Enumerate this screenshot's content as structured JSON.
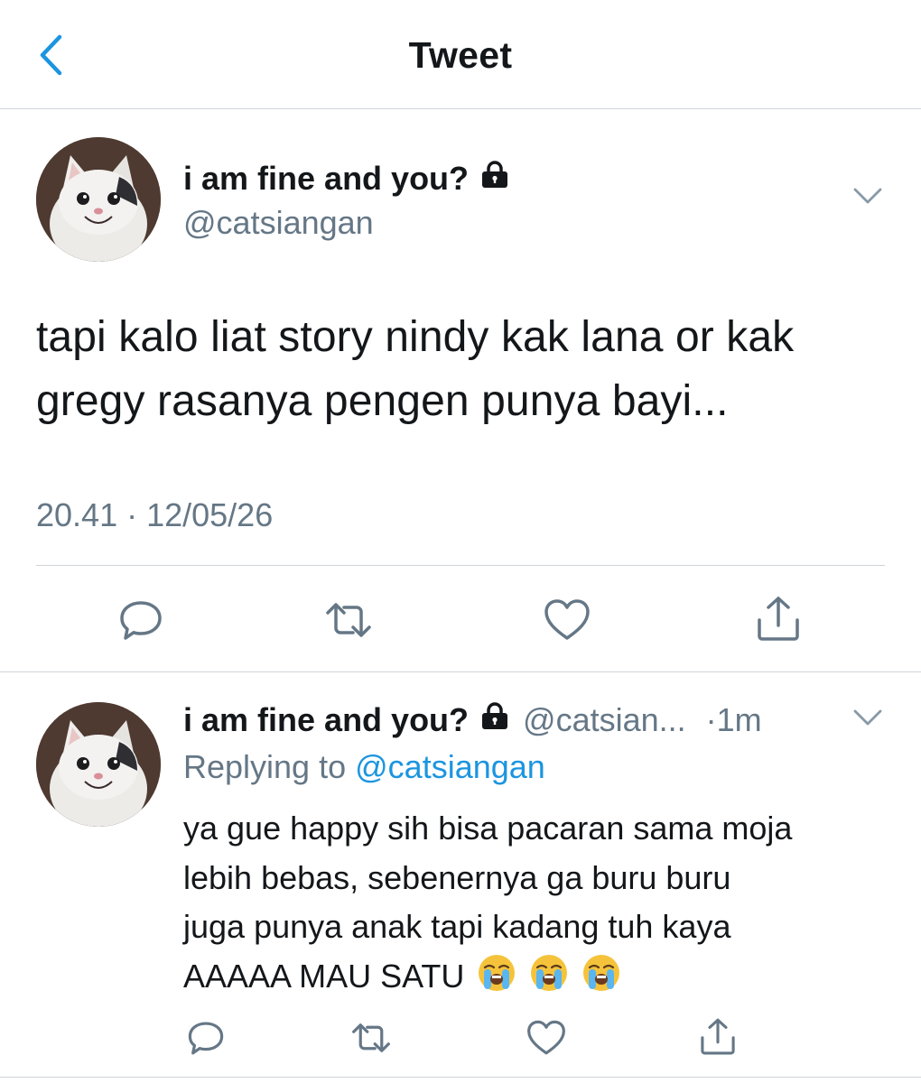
{
  "header": {
    "title": "Tweet"
  },
  "tweet": {
    "name": "i am fine and you?",
    "handle": "@catsiangan",
    "text": "tapi kalo liat story nindy kak lana or kak gregy rasanya pengen punya bayi...",
    "timestamp": "20.41 · 12/05/26"
  },
  "reply": {
    "name": "i am fine and you?",
    "handle": "@catsian...",
    "time": "·1m",
    "replying_prefix": "Replying to",
    "replying_handle": "@catsiangan",
    "text_lines": [
      "ya gue happy sih bisa pacaran sama moja",
      "lebih bebas, sebenernya ga buru buru",
      "juga punya anak tapi kadang tuh kaya",
      "AAAAA MAU SATU"
    ],
    "emojis": [
      "loudly-crying-face-emoji",
      "loudly-crying-face-emoji",
      "loudly-crying-face-emoji"
    ]
  },
  "icons": {
    "back": "chevron-left-icon",
    "lock": "lock-icon",
    "caret": "chevron-down-icon",
    "actions": [
      "reply-icon",
      "retweet-icon",
      "like-icon",
      "share-icon"
    ]
  },
  "colors": {
    "text": "#14171a",
    "secondary": "#657786",
    "link": "#1b95e0",
    "divider": "#cfd4d9",
    "back_arrow": "#1b95e0"
  }
}
